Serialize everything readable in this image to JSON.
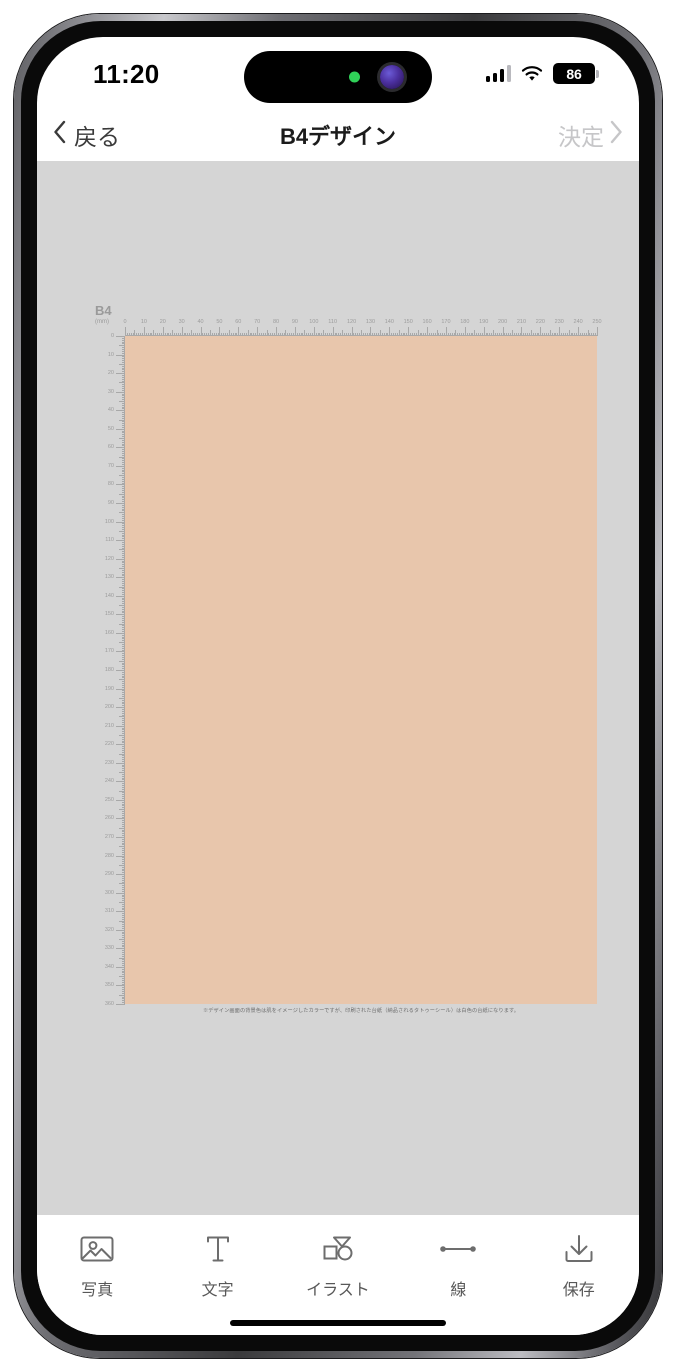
{
  "status_bar": {
    "time": "11:20",
    "battery_percent": "86",
    "signal_icon": "cellular-bars-icon",
    "wifi_icon": "wifi-icon",
    "battery_icon": "battery-icon",
    "camera_active_indicator": "green-recording-dot"
  },
  "nav_bar": {
    "back_label": "戻る",
    "title": "B4デザイン",
    "confirm_label": "決定",
    "back_icon": "chevron-left-icon",
    "confirm_icon": "chevron-right-icon",
    "confirm_color": "#c6c6c8"
  },
  "editor": {
    "background_color": "#d5d5d5",
    "size_label": "B4",
    "unit_label": "(mm)",
    "canvas_color": "#e8c6ac",
    "note": "※デザイン画面の背景色は肌をイメージしたカラーですが、印刷された台紙（納品されるタトゥーシール）は白色の台紙になります。",
    "ruler": {
      "horizontal_labels": [
        "0",
        "10",
        "20",
        "30",
        "40",
        "50",
        "60",
        "70",
        "80",
        "90",
        "100",
        "110",
        "120",
        "130",
        "140",
        "150",
        "160",
        "170",
        "180",
        "190",
        "200",
        "210",
        "220",
        "230",
        "240",
        "250"
      ],
      "vertical_labels": [
        "0",
        "10",
        "20",
        "30",
        "40",
        "50",
        "60",
        "70",
        "80",
        "90",
        "100",
        "110",
        "120",
        "130",
        "140",
        "150",
        "160",
        "170",
        "180",
        "190",
        "200",
        "210",
        "220",
        "230",
        "240",
        "250",
        "260",
        "270",
        "280",
        "290",
        "300",
        "310",
        "320",
        "330",
        "340",
        "350",
        "360"
      ],
      "unit": "mm",
      "h_max": 250,
      "v_max": 360
    }
  },
  "toolbar": {
    "items": [
      {
        "label": "写真",
        "icon": "photo-icon"
      },
      {
        "label": "文字",
        "icon": "text-icon"
      },
      {
        "label": "イラスト",
        "icon": "shapes-icon"
      },
      {
        "label": "線",
        "icon": "line-icon"
      },
      {
        "label": "保存",
        "icon": "download-icon"
      }
    ]
  }
}
